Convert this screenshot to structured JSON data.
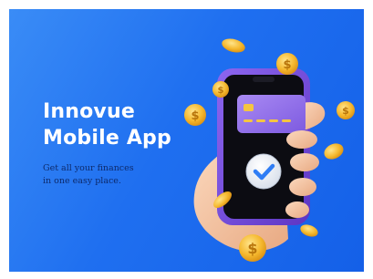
{
  "promo": {
    "headline_line1": "Innovue",
    "headline_line2": "Mobile App",
    "tagline_line1": "Get all your finances",
    "tagline_line2": "in one easy place."
  },
  "colors": {
    "background_start": "#3a8cf6",
    "background_end": "#1460e8",
    "headline": "#ffffff",
    "tagline": "#0d2a6b",
    "phone_frame": "#7b52e0",
    "card": "#9b79ee",
    "coin": "#f5b82e",
    "hand": "#f6c7a6",
    "check": "#2f7df5"
  },
  "icons": {
    "illustration": "hand-holding-phone-illustration",
    "card": "credit-card-icon",
    "check": "checkmark-icon",
    "coin": "dollar-coin-icon"
  }
}
